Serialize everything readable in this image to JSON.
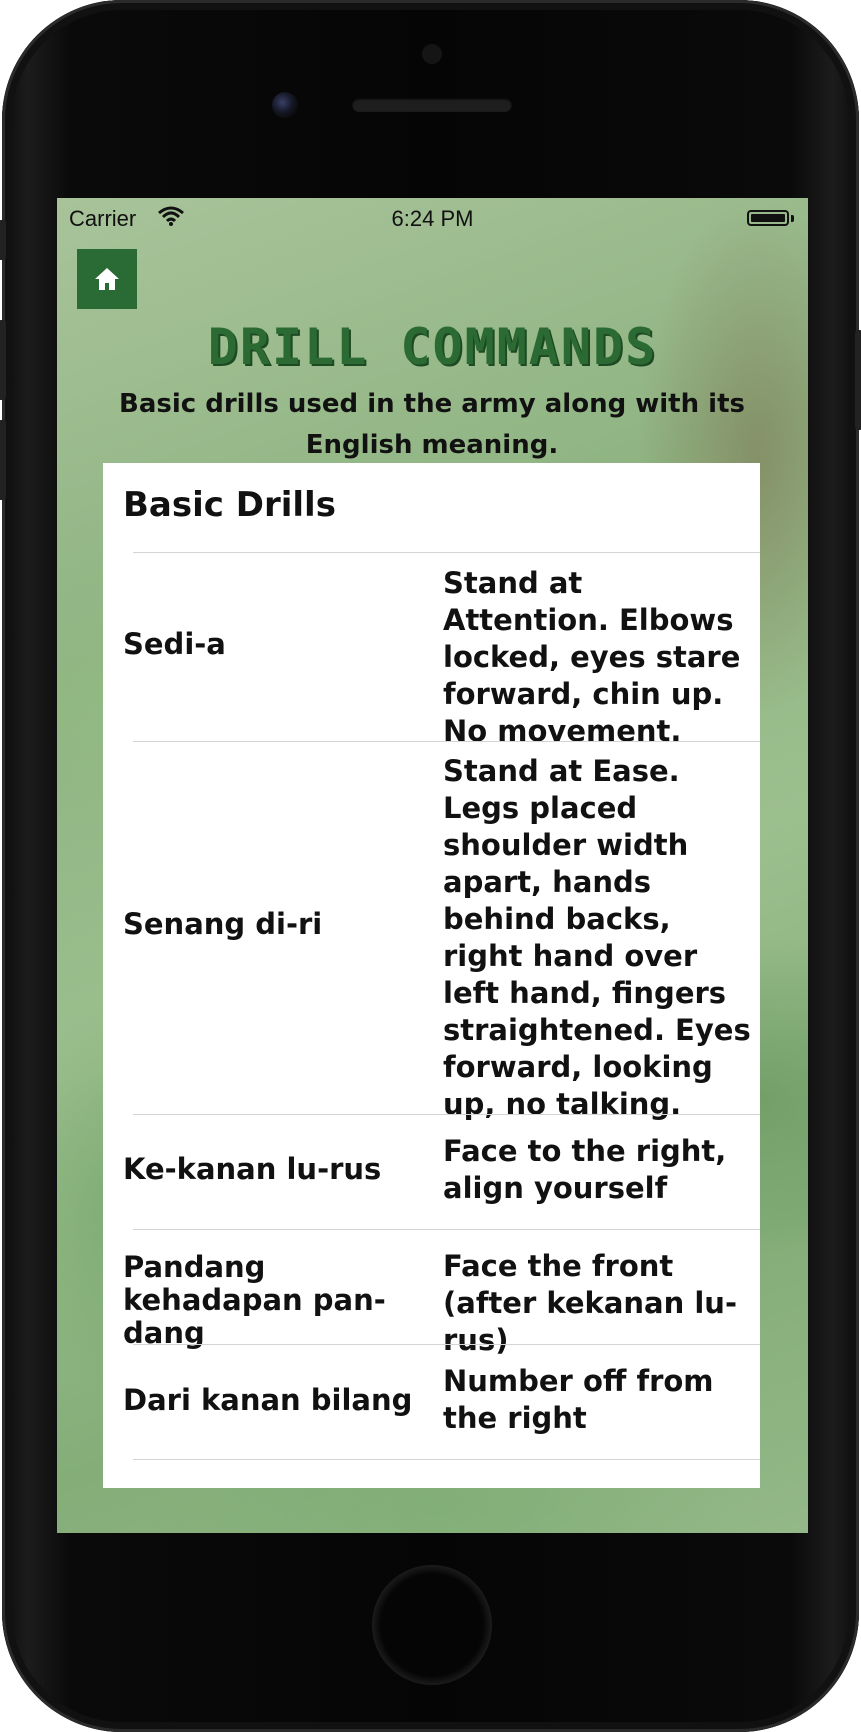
{
  "status_bar": {
    "carrier": "Carrier",
    "time": "6:24 PM"
  },
  "header": {
    "home_icon": "house-icon",
    "title": "DRILL COMMANDS",
    "subtitle": "Basic drills used in the army along with its English meaning."
  },
  "section": {
    "title": "Basic Drills",
    "rows": [
      {
        "command": "Sedi-a",
        "meaning": "Stand at Attention. Elbows locked, eyes stare forward, chin up. No movement."
      },
      {
        "command": "Senang di-ri",
        "meaning": "Stand at Ease. Legs placed shoulder width apart, hands behind backs, right hand over left hand, fingers straightened. Eyes forward, looking up, no talking."
      },
      {
        "command": "Ke-kanan lu-rus",
        "meaning": "Face to the right, align yourself"
      },
      {
        "command": "Pandang kehadapan pan-dang",
        "meaning": "Face the front (after kekanan lu-rus)"
      },
      {
        "command": "Dari kanan bilang",
        "meaning": "Number off from the right"
      }
    ]
  },
  "colors": {
    "accent_green": "#2a6a35",
    "title_green": "#2c6a34"
  }
}
